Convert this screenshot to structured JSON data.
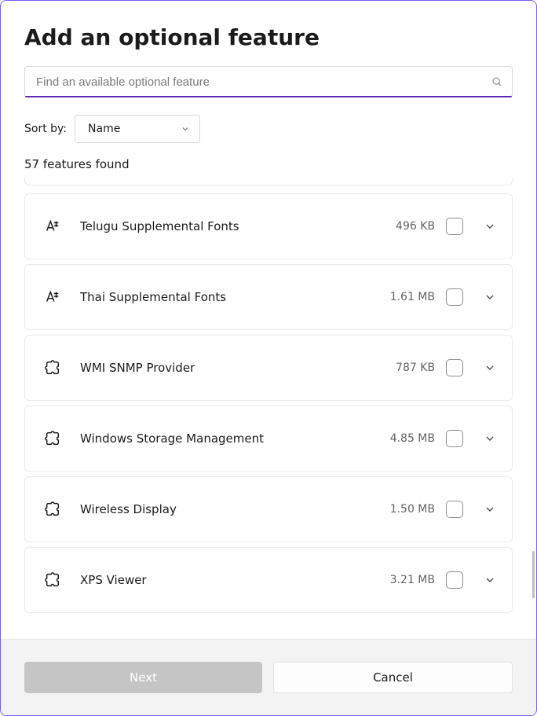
{
  "title": "Add an optional feature",
  "search": {
    "placeholder": "Find an available optional feature",
    "value": ""
  },
  "sort": {
    "label": "Sort by:",
    "selected": "Name"
  },
  "count_text": "57 features found",
  "features": [
    {
      "icon": "font",
      "name": "Telugu Supplemental Fonts",
      "size": "496 KB"
    },
    {
      "icon": "font",
      "name": "Thai Supplemental Fonts",
      "size": "1.61 MB"
    },
    {
      "icon": "puzzle",
      "name": "WMI SNMP Provider",
      "size": "787 KB"
    },
    {
      "icon": "puzzle",
      "name": "Windows Storage Management",
      "size": "4.85 MB"
    },
    {
      "icon": "puzzle",
      "name": "Wireless Display",
      "size": "1.50 MB"
    },
    {
      "icon": "puzzle",
      "name": "XPS Viewer",
      "size": "3.21 MB"
    }
  ],
  "footer": {
    "next": "Next",
    "cancel": "Cancel"
  }
}
